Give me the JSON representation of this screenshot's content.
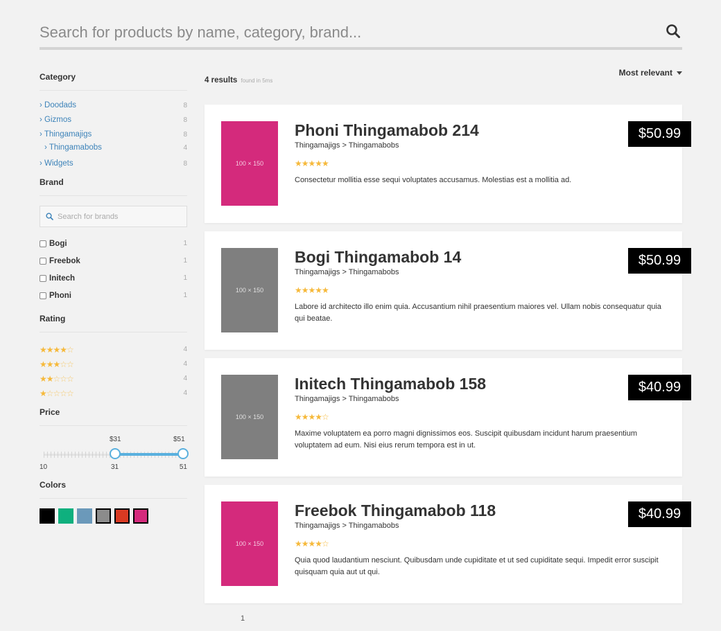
{
  "search": {
    "placeholder": "Search for products by name, category, brand..."
  },
  "sidebar": {
    "category": {
      "title": "Category",
      "items": [
        {
          "label": "› Doodads",
          "count": "8"
        },
        {
          "label": "› Gizmos",
          "count": "8"
        },
        {
          "label": "› Thingamajigs",
          "count": "8"
        },
        {
          "label": "› Thingamabobs",
          "count": "4"
        },
        {
          "label": "› Widgets",
          "count": "8"
        }
      ]
    },
    "brand": {
      "title": "Brand",
      "search_placeholder": "Search for brands",
      "items": [
        {
          "label": "Bogi",
          "count": "1"
        },
        {
          "label": "Freebok",
          "count": "1"
        },
        {
          "label": "Initech",
          "count": "1"
        },
        {
          "label": "Phoni",
          "count": "1"
        }
      ]
    },
    "rating": {
      "title": "Rating",
      "items": [
        {
          "stars_on": "★★★★",
          "stars_off": "☆",
          "count": "4"
        },
        {
          "stars_on": "★★★",
          "stars_off": "☆☆",
          "count": "4"
        },
        {
          "stars_on": "★★",
          "stars_off": "☆☆☆",
          "count": "4"
        },
        {
          "stars_on": "★",
          "stars_off": "☆☆☆☆",
          "count": "4"
        }
      ]
    },
    "price": {
      "title": "Price",
      "min_label": "10",
      "max_label": "51",
      "low_bound_label": "31",
      "low_tooltip": "$31",
      "high_tooltip": "$51",
      "range_min": 10,
      "range_max": 51,
      "low_value": 31,
      "high_value": 51
    },
    "colors": {
      "title": "Colors",
      "swatches": [
        "#000000",
        "#0fb07e",
        "#6b99ba",
        "#8c8c8c",
        "#d93a22",
        "#d42a7c"
      ]
    }
  },
  "results": {
    "count_label": "4 results",
    "time_label": "found in 5ms",
    "sort_label": "Most relevant"
  },
  "products": [
    {
      "title": "Phoni Thingamabob 214",
      "breadcrumb": "Thingamajigs > Thingamabobs",
      "stars": "★★★★★",
      "description": "Consectetur mollitia esse sequi voluptates accusamus. Molestias est a mollitia ad.",
      "price": "$50.99",
      "thumb_label": "100 × 150",
      "thumb_color": "#d42a7c"
    },
    {
      "title": "Bogi Thingamabob 14",
      "breadcrumb": "Thingamajigs > Thingamabobs",
      "stars": "★★★★★",
      "description": "Labore id architecto illo enim quia. Accusantium nihil praesentium maiores vel. Ullam nobis consequatur quia qui beatae.",
      "price": "$50.99",
      "thumb_label": "100 × 150",
      "thumb_color": "#7f7f7f"
    },
    {
      "title": "Initech Thingamabob 158",
      "breadcrumb": "Thingamajigs > Thingamabobs",
      "stars": "★★★★☆",
      "description": "Maxime voluptatem ea porro magni dignissimos eos. Suscipit quibusdam incidunt harum praesentium voluptatem ad eum. Nisi eius rerum tempora est in ut.",
      "price": "$40.99",
      "thumb_label": "100 × 150",
      "thumb_color": "#7f7f7f"
    },
    {
      "title": "Freebok Thingamabob 118",
      "breadcrumb": "Thingamajigs > Thingamabobs",
      "stars": "★★★★☆",
      "description": "Quia quod laudantium nesciunt. Quibusdam unde cupiditate et ut sed cupiditate sequi. Impedit error suscipit quisquam quia aut ut qui.",
      "price": "$40.99",
      "thumb_label": "100 × 150",
      "thumb_color": "#d42a7c"
    }
  ],
  "pagination": {
    "current": "1"
  }
}
